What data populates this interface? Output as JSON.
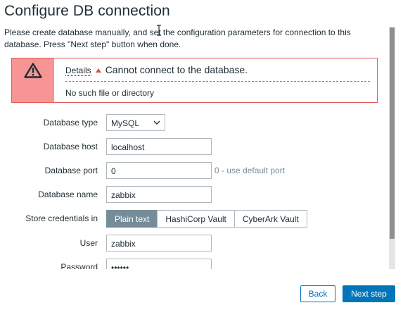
{
  "page": {
    "title": "Configure DB connection",
    "intro": "Please create database manually, and set the configuration parameters for connection to this database. Press \"Next step\" button when done."
  },
  "alert": {
    "details_label": "Details",
    "message": "Cannot connect to the database.",
    "detail": "No such file or directory",
    "icon": "warning-icon",
    "colors": {
      "border": "#e45959",
      "icon_bg": "#f79494"
    }
  },
  "form": {
    "db_type": {
      "label": "Database type",
      "value": "MySQL"
    },
    "db_host": {
      "label": "Database host",
      "value": "localhost"
    },
    "db_port": {
      "label": "Database port",
      "value": "0",
      "hint": "0 - use default port"
    },
    "db_name": {
      "label": "Database name",
      "value": "zabbix"
    },
    "store_credentials": {
      "label": "Store credentials in",
      "options": [
        "Plain text",
        "HashiCorp Vault",
        "CyberArk Vault"
      ],
      "selected": "Plain text"
    },
    "user": {
      "label": "User",
      "value": "zabbix"
    },
    "password": {
      "label": "Password",
      "value": "••••••"
    }
  },
  "buttons": {
    "back": "Back",
    "next": "Next step"
  },
  "colors": {
    "primary": "#0275b8",
    "segment_active": "#768d99"
  }
}
